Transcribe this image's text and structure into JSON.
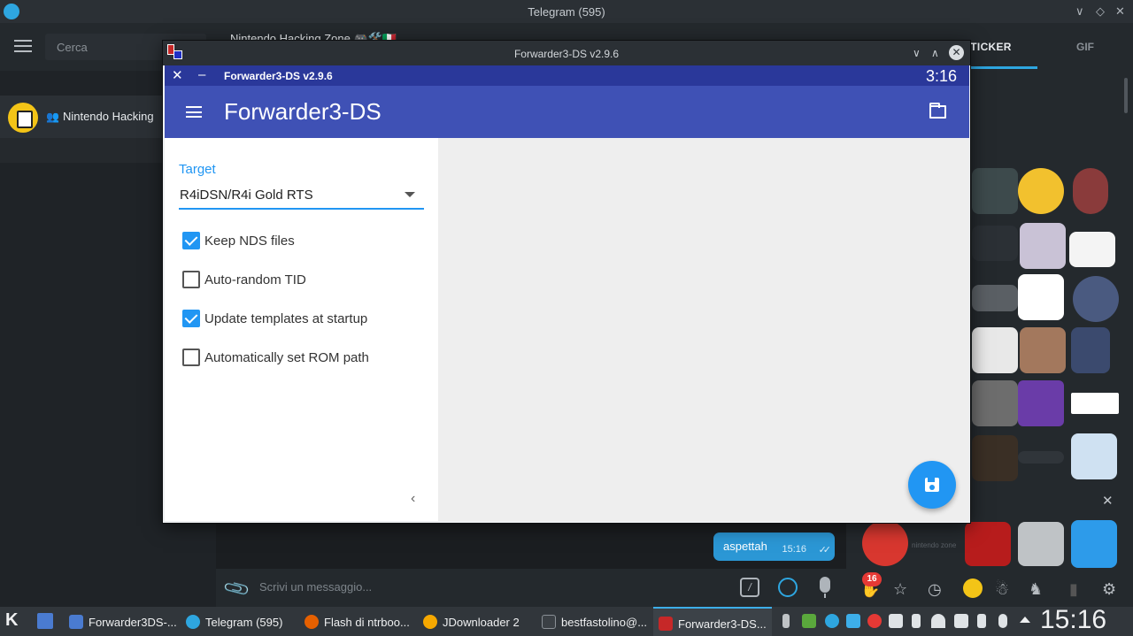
{
  "telegram": {
    "window_title": "Telegram (595)",
    "search_placeholder": "Cerca",
    "chat_list": [
      {
        "name": "Nintendo Hacking"
      }
    ],
    "chat_header_title": "Nintendo Hacking Zone 🎮🛠️🇮🇹",
    "message": {
      "text": "aspettah",
      "time": "15:16"
    },
    "compose_placeholder": "Scrivi un messaggio...",
    "sticker_tabs": [
      "STICKER",
      "GIF"
    ],
    "sticker_caption": "nintendo zone",
    "unread_badge": "16"
  },
  "forwarder": {
    "window_title": "Forwarder3-DS v2.9.6",
    "status_title": "Forwarder3-DS v2.9.6",
    "status_time": "3:16",
    "appbar_title": "Forwarder3-DS",
    "target_label": "Target",
    "target_value": "R4iDSN/R4i Gold RTS",
    "options": [
      {
        "label": "Keep NDS files",
        "checked": true
      },
      {
        "label": "Auto-random TID",
        "checked": false
      },
      {
        "label": "Update templates at startup",
        "checked": true
      },
      {
        "label": "Automatically set ROM path",
        "checked": false
      }
    ]
  },
  "taskbar": {
    "items": [
      {
        "label": "Forwarder3DS-...",
        "icon": "app-window-icon",
        "color": "#4a7bd0"
      },
      {
        "label": "Telegram (595)",
        "icon": "telegram-icon",
        "color": "#2ea6e0"
      },
      {
        "label": "Flash di ntrboo...",
        "icon": "firefox-icon",
        "color": "#e66000"
      },
      {
        "label": "JDownloader 2",
        "icon": "jdownloader-icon",
        "color": "#f6a800"
      },
      {
        "label": "bestfastolino@...",
        "icon": "terminal-icon",
        "color": "#3b4045"
      },
      {
        "label": "Forwarder3-DS...",
        "icon": "forwarder-icon",
        "color": "#c62828"
      }
    ],
    "clock": "15:16"
  },
  "colors": {
    "accent": "#3f51b5",
    "primary_dark": "#2a389a",
    "checkbox": "#2196f3",
    "telegram_blue": "#2b97d5"
  }
}
